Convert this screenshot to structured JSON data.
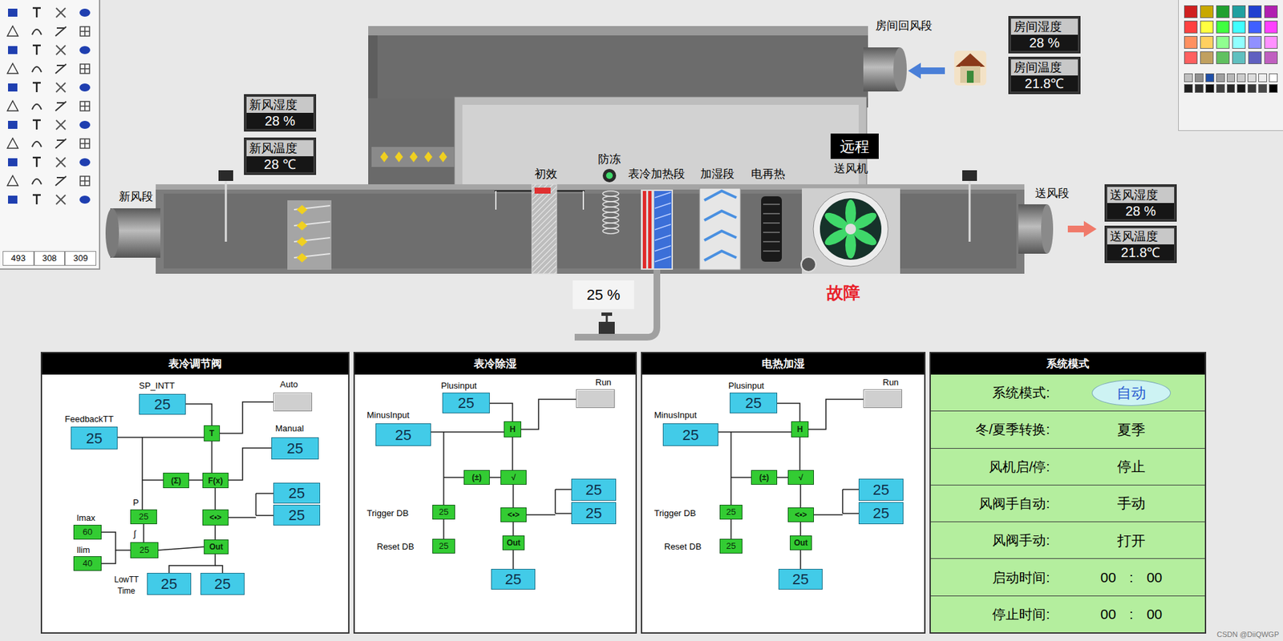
{
  "toolbar": {
    "readouts": [
      "493",
      "308",
      "309"
    ]
  },
  "palette": {
    "swatches": [
      "#d02020",
      "#c8a800",
      "#20a030",
      "#20a0a0",
      "#2040d0",
      "#b020b0",
      "#ff4040",
      "#ffff40",
      "#40ff40",
      "#40ffff",
      "#4060ff",
      "#ff40ff",
      "#ff9060",
      "#ffd060",
      "#90ff90",
      "#90ffff",
      "#9090ff",
      "#ff90ff",
      "#ff6060",
      "#c0a060",
      "#60c060",
      "#60c0c0",
      "#6060c0",
      "#c060c0"
    ],
    "grays": [
      "#c0c0c0",
      "#909090",
      "#1f4fa8",
      "#a0a0a0",
      "#b8b8b8",
      "#cccccc",
      "#dddddd",
      "#eeeeee",
      "#ffffff",
      "#202020",
      "#303030",
      "#101010",
      "#404040",
      "#282828",
      "#181818",
      "#383838",
      "#484848",
      "#000000"
    ]
  },
  "diagram": {
    "fresh_section": "新风段",
    "return_section": "房间回风段",
    "supply_section": "送风段",
    "filter": "初效",
    "antifreeze": "防冻",
    "coil": "表冷加热段",
    "humidifier": "加湿段",
    "reheat": "电再热",
    "fan": "送风机",
    "fan_mode": "远程",
    "fan_status": "故障",
    "fan_fault": true,
    "valve_reading": "25 %",
    "fresh_air": [
      {
        "label": "新风湿度",
        "value": "28 %"
      },
      {
        "label": "新风温度",
        "value": "28 ℃"
      }
    ],
    "room": [
      {
        "label": "房间湿度",
        "value": "28 %"
      },
      {
        "label": "房间温度",
        "value": "21.8℃"
      }
    ],
    "supply_air": [
      {
        "label": "送风湿度",
        "value": "28 %"
      },
      {
        "label": "送风温度",
        "value": "21.8℃"
      }
    ]
  },
  "valve_panel": {
    "title": "表冷调节阀",
    "sp_label": "SP_INTT",
    "sp": "25",
    "auto_label": "Auto",
    "auto_active": false,
    "feedback_label": "FeedbackTT",
    "feedback": "25",
    "manual_label": "Manual",
    "manual": "25",
    "t": "T",
    "sum": "(Σ)",
    "fx": "F(x)",
    "limit": "<•>",
    "out": "Out",
    "p_label": "P",
    "p": "25",
    "i_label": "∫",
    "i": "25",
    "imax_label": "lmax",
    "imax": "60",
    "ilim_label": "llim",
    "ilim": "40",
    "lowtt_label": "LowTT",
    "time_label": "Time",
    "low_values": [
      "25",
      "25"
    ],
    "outputs": [
      "25",
      "25"
    ]
  },
  "dehumid_panel": {
    "title": "表冷除湿",
    "plus_label": "Plusinput",
    "plus": "25",
    "run_label": "Run",
    "run_active": false,
    "minus_label": "MinusInput",
    "minus": "25",
    "h": "H",
    "pm": "(±)",
    "sqrt": "√",
    "limit": "<•>",
    "out": "Out",
    "trigger_label": "Trigger DB",
    "trigger": "25",
    "reset_label": "Reset DB",
    "reset": "25",
    "outputs": [
      "25",
      "25"
    ],
    "output": "25"
  },
  "humid_panel": {
    "title": "电热加湿",
    "plus_label": "Plusinput",
    "plus": "25",
    "run_label": "Run",
    "run_active": false,
    "minus_label": "MinusInput",
    "minus": "25",
    "h": "H",
    "pm": "(±)",
    "sqrt": "√",
    "limit": "<•>",
    "out": "Out",
    "trigger_label": "Trigger DB",
    "trigger": "25",
    "reset_label": "Reset DB",
    "reset": "25",
    "outputs": [
      "25",
      "25"
    ],
    "output": "25"
  },
  "system_panel": {
    "title": "系统模式",
    "rows": [
      {
        "label": "系统模式:",
        "kind": "badge",
        "value": "自动"
      },
      {
        "label": "冬/夏季转换:",
        "kind": "text",
        "value": "夏季"
      },
      {
        "label": "风机启/停:",
        "kind": "text",
        "value": "停止"
      },
      {
        "label": "风阀手自动:",
        "kind": "text",
        "value": "手动"
      },
      {
        "label": "风阀手动:",
        "kind": "text",
        "value": "打开"
      },
      {
        "label": "启动时间:",
        "kind": "time",
        "hour": "00",
        "sep": ":",
        "minute": "00"
      },
      {
        "label": "停止时间:",
        "kind": "time",
        "hour": "00",
        "sep": ":",
        "minute": "00"
      }
    ]
  },
  "watermark": "CSDN @DiiQWGP"
}
